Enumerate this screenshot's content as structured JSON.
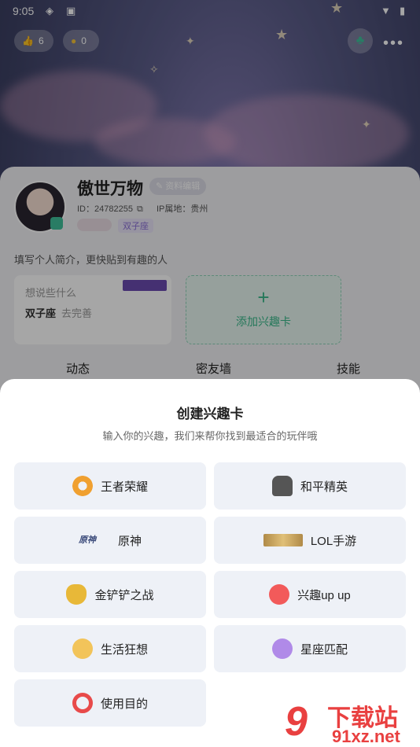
{
  "status_bar": {
    "time": "9:05"
  },
  "top_bar": {
    "likes_count": "6",
    "coins_count": "0"
  },
  "profile": {
    "username": "傲世万物",
    "edit_label": "资料编辑",
    "id_label": "ID：24782255",
    "ip_label": "IP属地：贵州",
    "zodiac_tag": "双子座",
    "bio_placeholder": "填写个人简介，更快贴到有趣的人",
    "card_prompt": "想说些什么",
    "card_zodiac": "双子座",
    "card_action": "去完善",
    "add_card_label": "添加兴趣卡"
  },
  "tabs": [
    "动态",
    "密友墙",
    "技能"
  ],
  "sheet": {
    "title": "创建兴趣卡",
    "subtitle": "输入你的兴趣，我们来帮你找到最适合的玩伴哦",
    "options": [
      {
        "label": "王者荣耀",
        "icon": "honor-of-kings-icon"
      },
      {
        "label": "和平精英",
        "icon": "peace-elite-icon"
      },
      {
        "label": "原神",
        "icon": "genshin-icon"
      },
      {
        "label": "LOL手游",
        "icon": "lol-mobile-icon"
      },
      {
        "label": "金铲铲之战",
        "icon": "golden-spatula-icon"
      },
      {
        "label": "兴趣up up",
        "icon": "balloon-icon"
      },
      {
        "label": "生活狂想",
        "icon": "cat-icon"
      },
      {
        "label": "星座匹配",
        "icon": "zodiac-icon"
      },
      {
        "label": "使用目的",
        "icon": "target-icon"
      }
    ],
    "genshin_logo_text": "原神"
  },
  "watermark": {
    "text": "下载站",
    "url": "91xz.net",
    "number": "9"
  }
}
